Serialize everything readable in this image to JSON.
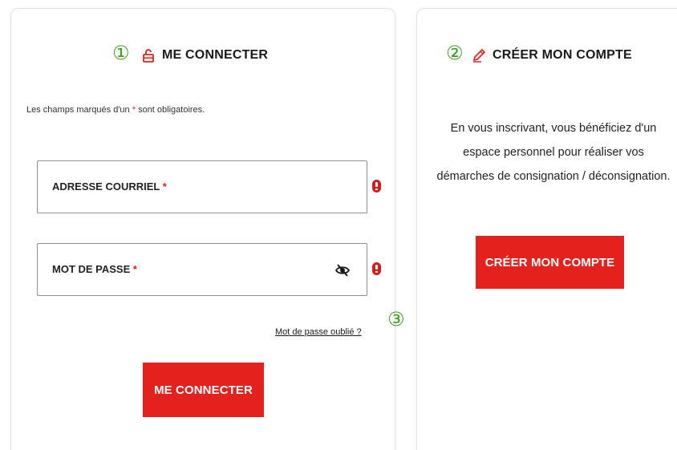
{
  "markers": {
    "one": "①",
    "two": "②",
    "three": "③"
  },
  "login": {
    "title": "ME CONNECTER",
    "required_note_before": "Les champs marqués d'un ",
    "required_note_asterisk": "*",
    "required_note_after": " sont obligatoires.",
    "email_label": "ADRESSE COURRIEL",
    "email_value": "",
    "password_label": "MOT DE PASSE",
    "password_value": "",
    "required_asterisk": " *",
    "forgot_link": "Mot de passe oublié ?",
    "submit_label": "ME CONNECTER"
  },
  "signup": {
    "title": "CRÉER MON COMPTE",
    "description": "En vous inscrivant, vous bénéficiez d'un espace personnel pour réaliser vos démarches de consignation / déconsignation.",
    "button_label": "CRÉER MON COMPTE"
  },
  "icons": {
    "login_title_icon": "unlock-icon",
    "signup_title_icon": "pencil-icon",
    "password_toggle_icon": "eye-slash-icon",
    "error_icon": "exclamation-icon"
  },
  "colors": {
    "accent_red": "#e4211c",
    "error_red": "#d61b1b",
    "marker_green": "#3a9f1a",
    "field_border": "#8c9197"
  }
}
